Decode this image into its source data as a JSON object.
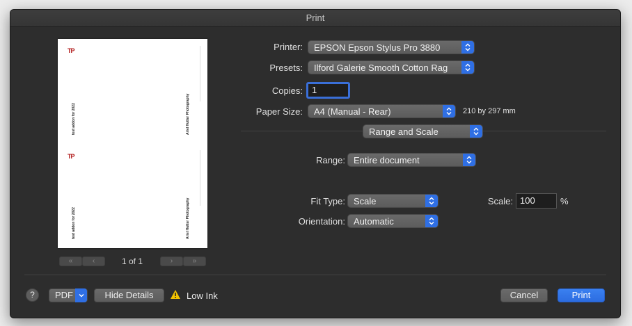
{
  "window": {
    "title": "Print"
  },
  "preview": {
    "page_indicator": "1 of 1",
    "text_left": "test addon for 2022",
    "text_right": "Ariel Hutter Photography",
    "logo_text": "TP"
  },
  "form": {
    "printer_label": "Printer:",
    "printer_value": "EPSON Epson Stylus Pro 3880",
    "presets_label": "Presets:",
    "presets_value": "Ilford Galerie Smooth Cotton Rag",
    "copies_label": "Copies:",
    "copies_value": "1",
    "paper_size_label": "Paper Size:",
    "paper_size_value": "A4 (Manual - Rear)",
    "paper_size_dims": "210 by 297 mm",
    "section_value": "Range and Scale",
    "range_label": "Range:",
    "range_value": "Entire document",
    "fit_type_label": "Fit Type:",
    "fit_type_value": "Scale",
    "scale_label": "Scale:",
    "scale_value": "100",
    "scale_unit": "%",
    "orientation_label": "Orientation:",
    "orientation_value": "Automatic"
  },
  "footer": {
    "help_label": "?",
    "pdf_label": "PDF",
    "hide_details_label": "Hide Details",
    "low_ink_label": "Low Ink",
    "cancel_label": "Cancel",
    "print_label": "Print"
  },
  "colors": {
    "accent": "#2f6fe4",
    "window_bg": "#2d2d2d",
    "warning": "#f2c200"
  },
  "icons": [
    "first-page-icon",
    "prev-page-icon",
    "next-page-icon",
    "last-page-icon",
    "chevron-updown-icon",
    "chevron-down-icon",
    "warning-icon",
    "help-icon"
  ]
}
